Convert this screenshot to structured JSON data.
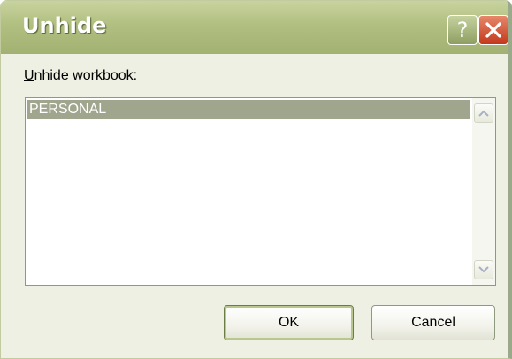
{
  "dialog": {
    "title": "Unhide",
    "help_glyph": "?",
    "label_accel": "U",
    "label_rest": "nhide workbook:",
    "items": [
      "PERSONAL"
    ],
    "selected_index": 0,
    "ok_label": "OK",
    "cancel_label": "Cancel"
  },
  "icons": {
    "help": "question-mark-icon",
    "close": "close-x-icon",
    "scroll_up": "chevron-up-icon",
    "scroll_down": "chevron-down-icon"
  },
  "colors": {
    "titlebar": "#b1bf80",
    "close_button": "#c3381b",
    "selection": "#a0a68e",
    "dialog_background": "#eef0e3"
  }
}
